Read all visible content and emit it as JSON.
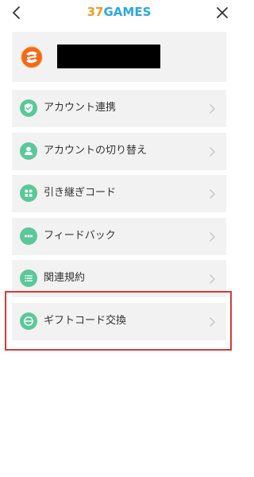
{
  "header": {
    "logo_number": "37",
    "logo_word": "GAMES",
    "back_icon": "chevron-left-icon",
    "close_icon": "close-icon"
  },
  "profile": {
    "avatar_icon": "37games-logo-icon",
    "name_redacted": true
  },
  "menu": {
    "items": [
      {
        "label": "アカウント連携",
        "icon": "shield-check-icon"
      },
      {
        "label": "アカウントの切り替え",
        "icon": "user-icon"
      },
      {
        "label": "引き継ぎコード",
        "icon": "grid-icon"
      },
      {
        "label": "フィードバック",
        "icon": "ellipsis-icon"
      },
      {
        "label": "関連規約",
        "icon": "list-icon"
      },
      {
        "label": "ギフトコード交換",
        "icon": "gift-exchange-icon"
      }
    ]
  },
  "colors": {
    "accent_green": "#5bc89a",
    "logo_orange": "#f39c1f",
    "logo_blue": "#2aa8e0",
    "highlight_red": "#d43a3a",
    "item_background": "#f2f2f2"
  }
}
